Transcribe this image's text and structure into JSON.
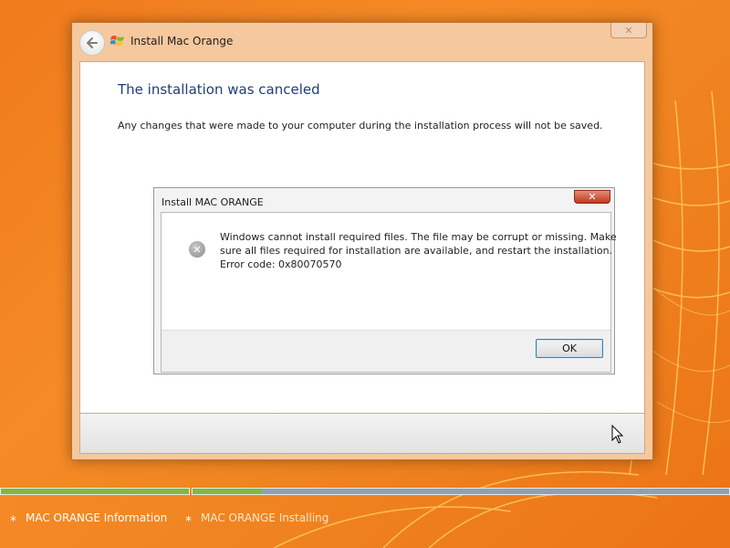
{
  "window": {
    "title": "Install Mac Orange",
    "heading": "The installation was canceled",
    "description": "Any changes that were made to your computer during the installation process will not be saved."
  },
  "dialog": {
    "title": "Install MAC ORANGE",
    "message_lines": [
      "Windows cannot install required files. The file may be corrupt or missing. Make",
      "sure all files required for installation are available, and restart the installation.",
      "Error code: 0x80070570"
    ],
    "ok_label": "OK"
  },
  "progress": {
    "steps": [
      {
        "label": "MAC ORANGE Information",
        "fraction_complete": 1.0
      },
      {
        "label": "MAC ORANGE Installing",
        "fraction_complete": 0.13
      }
    ]
  },
  "colors": {
    "background": "#f58a26",
    "heading": "#1f3d7a",
    "progress_done": "#7fba3c",
    "progress_remaining": "#8fa0b0",
    "dialog_close": "#c0391f"
  },
  "icons": {
    "back": "back-arrow-icon",
    "logo": "windows-logo-icon",
    "error": "error-icon",
    "close": "close-icon",
    "step": "asterisk-icon"
  }
}
